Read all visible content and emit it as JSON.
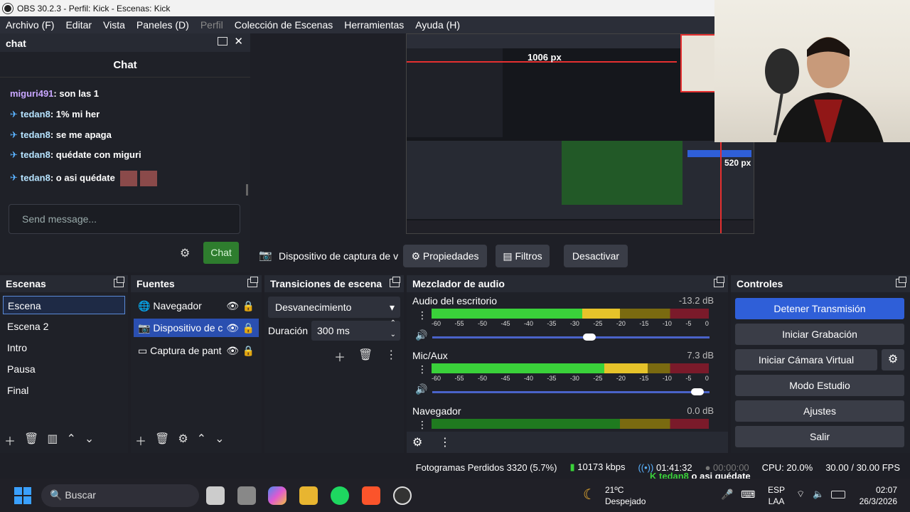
{
  "window": {
    "title": "OBS 30.2.3 - Perfil: Kick - Escenas: Kick"
  },
  "menu": [
    "Archivo (F)",
    "Editar",
    "Vista",
    "Paneles (D)",
    "Perfil",
    "Colección de Escenas",
    "Herramientas",
    "Ayuda (H)"
  ],
  "chat": {
    "dock_title": "chat",
    "title": "Chat",
    "messages": [
      {
        "user": "miguri491",
        "text": "son las 1"
      },
      {
        "user": "tedan8",
        "text": "1% mi her"
      },
      {
        "user": "tedan8",
        "text": "se me apaga"
      },
      {
        "user": "tedan8",
        "text": "quédate con miguri"
      },
      {
        "user": "tedan8",
        "text": "o asi quédate"
      }
    ],
    "input_placeholder": "Send message...",
    "send_label": "Chat"
  },
  "preview": {
    "label_width": "1006 px",
    "label_height": "520 px"
  },
  "source_toolbar": {
    "source_name": "Dispositivo de captura de v",
    "properties": "Propiedades",
    "filters": "Filtros",
    "deactivate": "Desactivar"
  },
  "scenes": {
    "title": "Escenas",
    "items": [
      "Escena",
      "Escena 2",
      "Intro",
      "Pausa",
      "Final"
    ]
  },
  "sources": {
    "title": "Fuentes",
    "items": [
      "Navegador",
      "Dispositivo de c",
      "Captura de pant"
    ]
  },
  "transitions": {
    "title": "Transiciones de escena",
    "selected": "Desvanecimiento",
    "duration_label": "Duración",
    "duration_value": "300 ms"
  },
  "mixer": {
    "title": "Mezclador de audio",
    "scale": [
      "-60",
      "-55",
      "-50",
      "-45",
      "-40",
      "-35",
      "-30",
      "-25",
      "-20",
      "-15",
      "-10",
      "-5",
      "0"
    ],
    "channels": [
      {
        "name": "Audio del escritorio",
        "db": "-13.2 dB",
        "level": 0.68,
        "volume": 0.59
      },
      {
        "name": "Mic/Aux",
        "db": "7.3 dB",
        "level": 0.78,
        "volume": 0.98
      },
      {
        "name": "Navegador",
        "db": "0.0 dB",
        "level": 0.0,
        "volume": 1.0
      }
    ]
  },
  "controls": {
    "title": "Controles",
    "stop_stream": "Detener Transmisión",
    "start_record": "Iniciar Grabación",
    "start_vcam": "Iniciar Cámara Virtual",
    "studio_mode": "Modo Estudio",
    "settings": "Ajustes",
    "exit": "Salir"
  },
  "status": {
    "dropped": "Fotogramas Perdidos 3320 (5.7%)",
    "bitrate": "10173 kbps",
    "stream_time": "01:41:32",
    "rec_time": "00:00:00",
    "cpu": "CPU: 20.0%",
    "fps": "30.00 / 30.00 FPS"
  },
  "overlay": {
    "user": "tedan8",
    "text": "o asi quédate"
  },
  "taskbar": {
    "search": "Buscar",
    "weather_temp": "21ºC",
    "weather_desc": "Despejado",
    "lang1": "ESP",
    "lang2": "LAA",
    "time": "02:07",
    "date": "26/3/2026"
  },
  "colors": {
    "accent": "#2f5fd8",
    "chat_button": "#2e7d2e",
    "panel_bg": "#1f2128"
  }
}
